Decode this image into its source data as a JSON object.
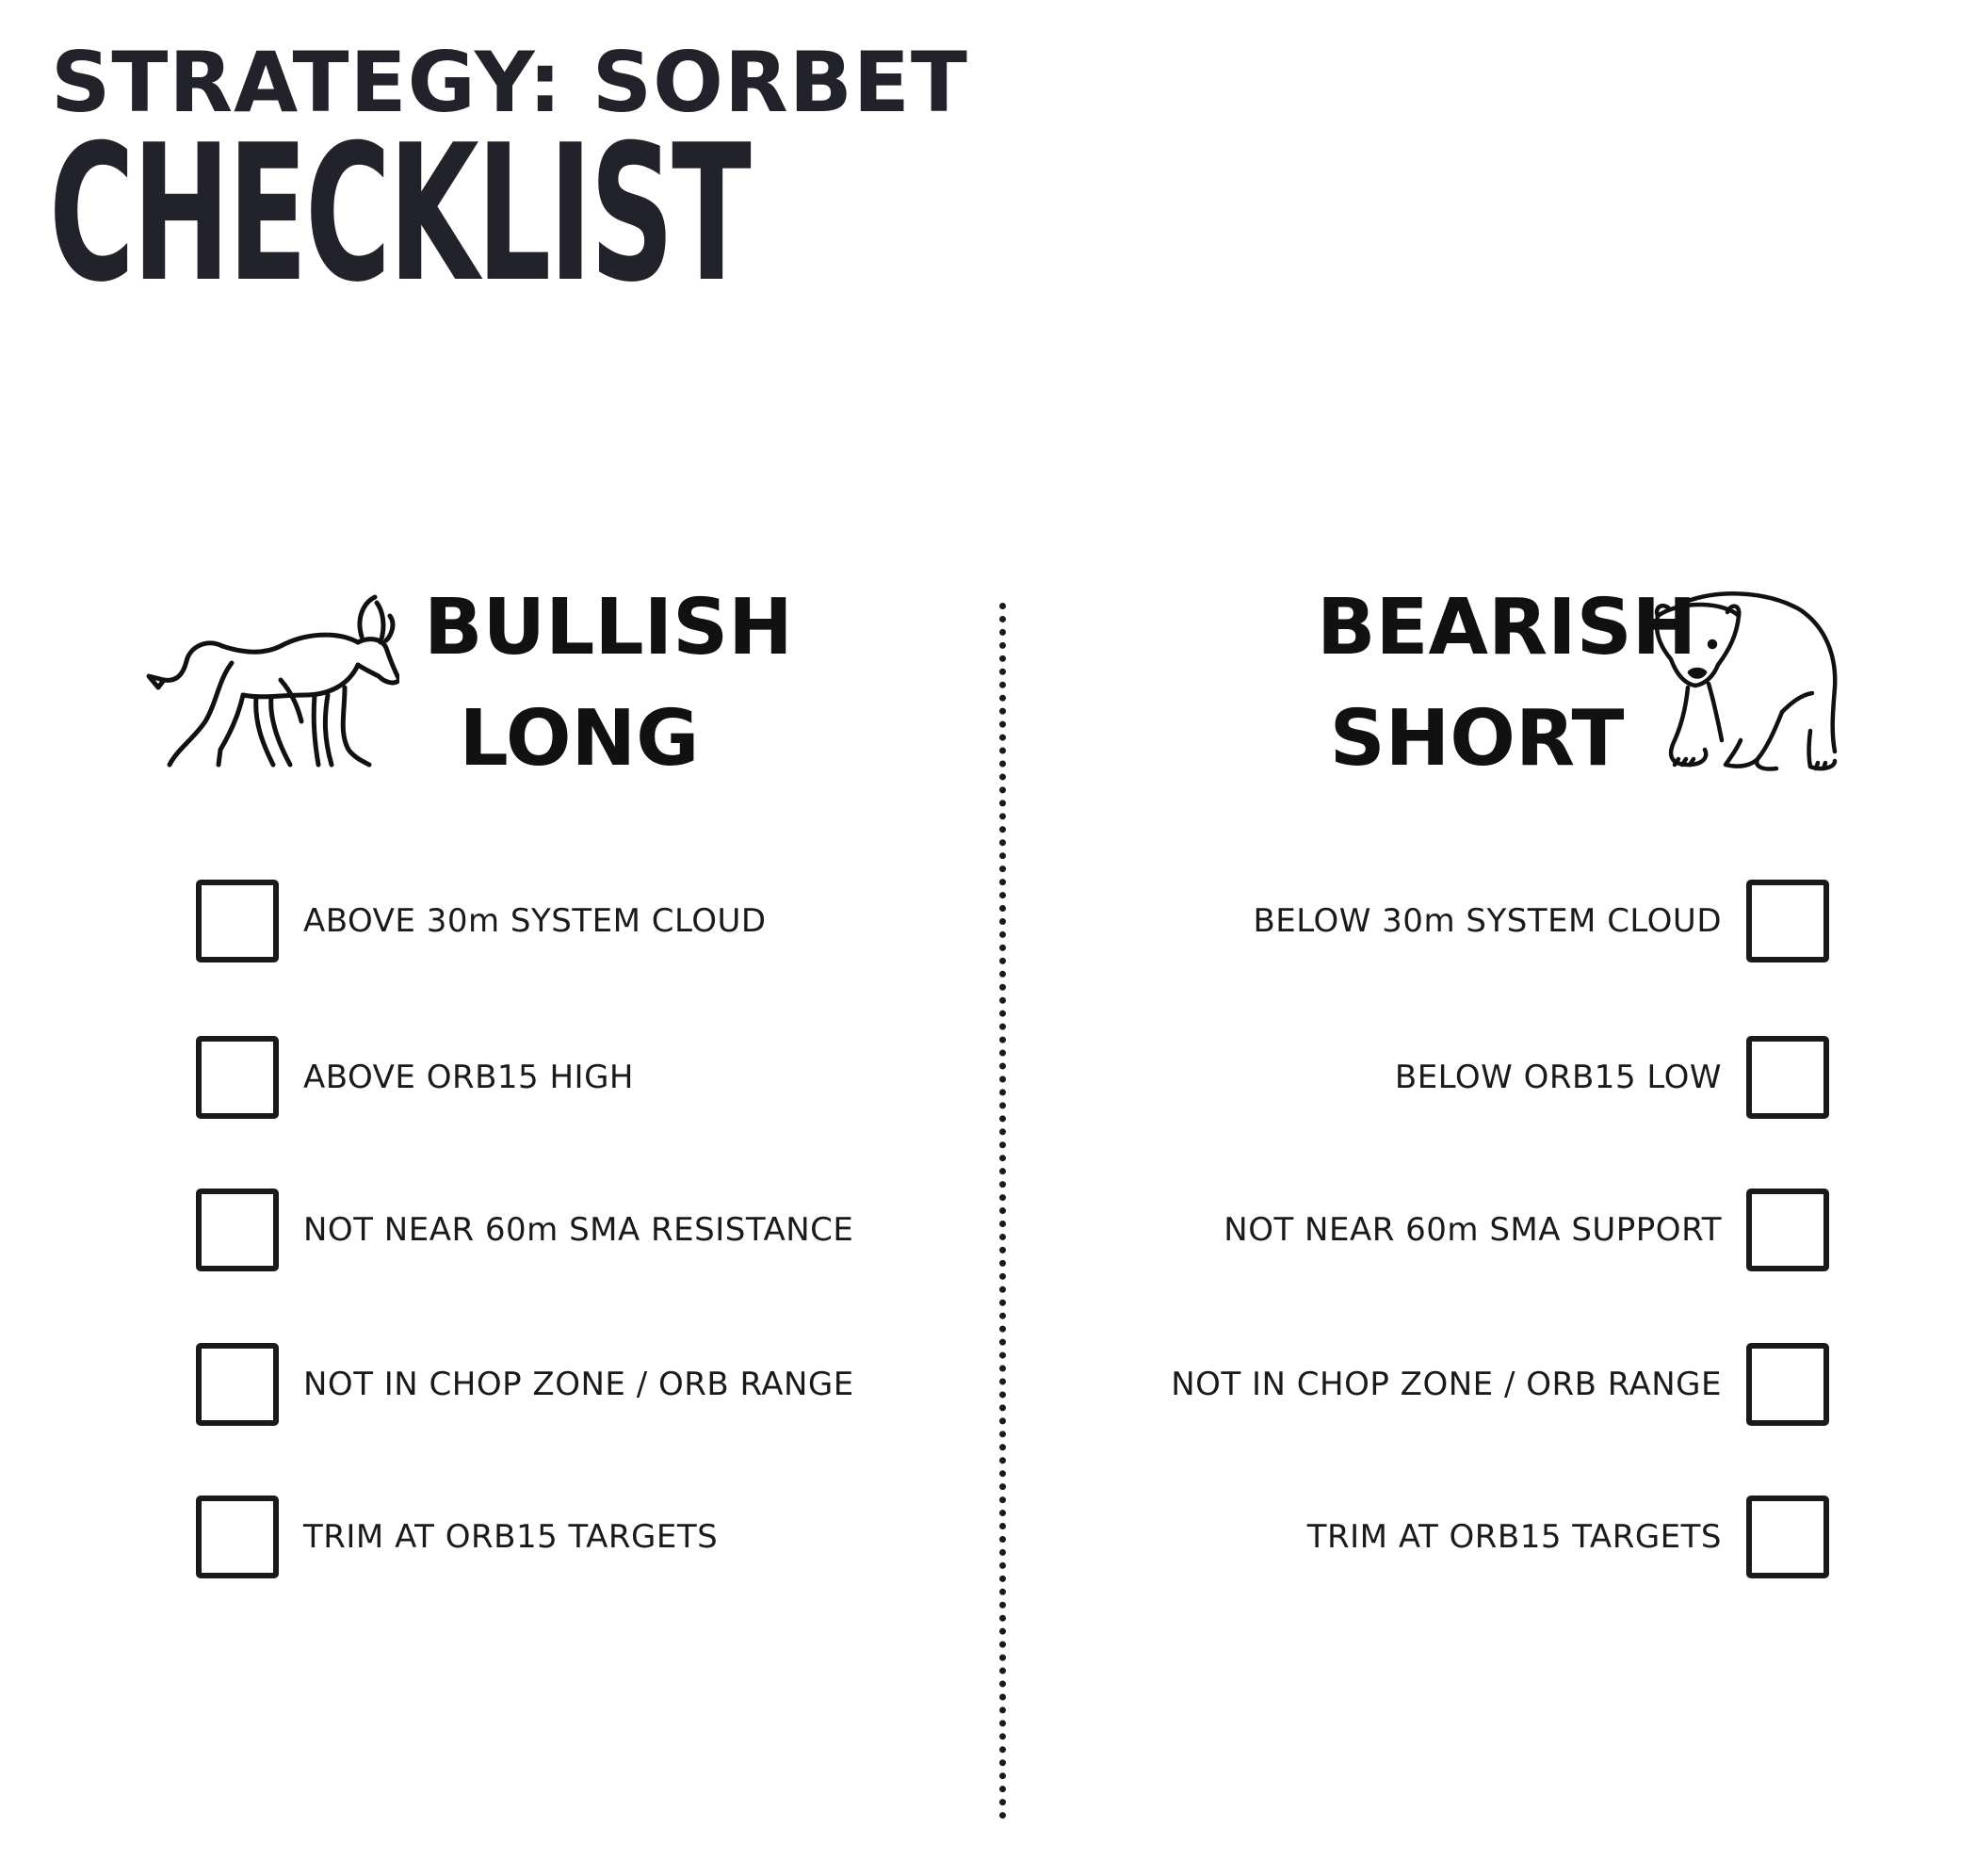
{
  "header": {
    "strategy": "STRATEGY: SORBET",
    "title": "CHECKLIST"
  },
  "bullish": {
    "heading_line1": "BULLISH",
    "heading_line2": "LONG",
    "icon": "bull-icon",
    "items": [
      {
        "label": "ABOVE 30m SYSTEM CLOUD",
        "checked": false
      },
      {
        "label": "ABOVE ORB15 HIGH",
        "checked": false
      },
      {
        "label": "NOT NEAR 60m SMA RESISTANCE",
        "checked": false
      },
      {
        "label": "NOT IN CHOP ZONE / ORB RANGE",
        "checked": false
      },
      {
        "label": "TRIM AT ORB15 TARGETS",
        "checked": false
      }
    ]
  },
  "bearish": {
    "heading_line1": "BEARISH",
    "heading_line2": "SHORT",
    "icon": "bear-icon",
    "items": [
      {
        "label": "BELOW 30m SYSTEM CLOUD",
        "checked": false
      },
      {
        "label": "BELOW ORB15 LOW",
        "checked": false
      },
      {
        "label": "NOT NEAR 60m SMA SUPPORT",
        "checked": false
      },
      {
        "label": "NOT IN CHOP ZONE / ORB RANGE",
        "checked": false
      },
      {
        "label": "TRIM AT ORB15 TARGETS",
        "checked": false
      }
    ]
  },
  "colors": {
    "text": "#22222b",
    "ink": "#1a1a1a",
    "background": "#ffffff"
  }
}
